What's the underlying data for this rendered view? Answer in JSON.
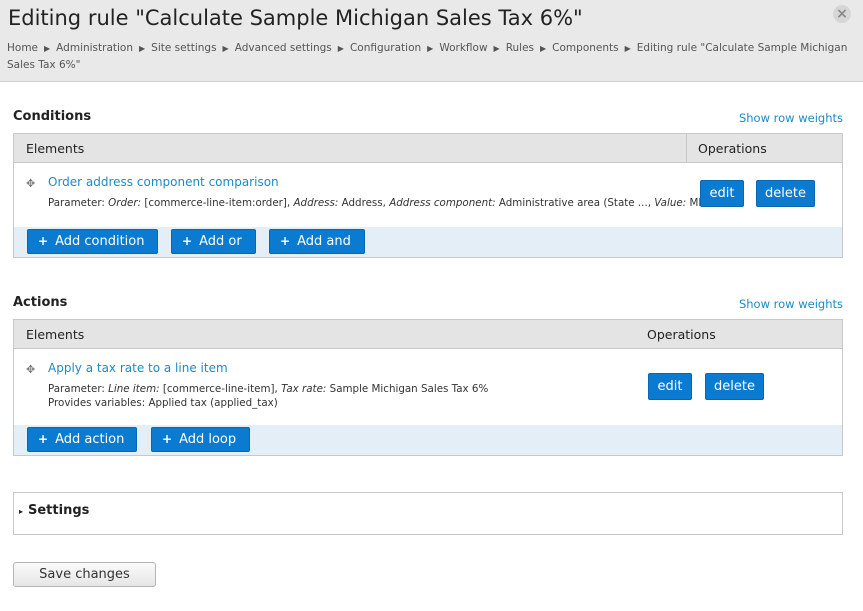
{
  "header": {
    "title": "Editing rule \"Calculate Sample Michigan Sales Tax 6%\"",
    "close_label": "×",
    "breadcrumb": [
      "Home",
      "Administration",
      "Site settings",
      "Advanced settings",
      "Configuration",
      "Workflow",
      "Rules",
      "Components",
      "Editing rule \"Calculate Sample Michigan Sales Tax 6%\""
    ],
    "breadcrumb_separator": "▶"
  },
  "conditions": {
    "title": "Conditions",
    "row_weights_link": "Show row weights",
    "col_elements": "Elements",
    "col_operations": "Operations",
    "row": {
      "label": "Order address component comparison",
      "param_prefix": "Parameter: ",
      "params": [
        {
          "name": "Order:",
          "value": " [commerce-line-item:order], "
        },
        {
          "name": "Address:",
          "value": " Address, "
        },
        {
          "name": "Address component:",
          "value": " Administrative area (State ..., "
        },
        {
          "name": "Value:",
          "value": " MI"
        }
      ],
      "edit_label": "edit",
      "delete_label": "delete"
    },
    "add_buttons": [
      "Add condition",
      "Add or",
      "Add and"
    ]
  },
  "actions": {
    "title": "Actions",
    "row_weights_link": "Show row weights",
    "col_elements": "Elements",
    "col_operations": "Operations",
    "row": {
      "label": "Apply a tax rate to a line item",
      "param_prefix": "Parameter: ",
      "params": [
        {
          "name": "Line item:",
          "value": " [commerce-line-item], "
        },
        {
          "name": "Tax rate:",
          "value": " Sample Michigan Sales Tax 6%"
        }
      ],
      "provides": "Provides variables: Applied tax (applied_tax)",
      "edit_label": "edit",
      "delete_label": "delete"
    },
    "add_buttons": [
      "Add action",
      "Add loop"
    ]
  },
  "settings": {
    "label": "Settings",
    "toggle_icon": "▸"
  },
  "save_button": "Save changes",
  "colors": {
    "accent": "#0a7bd0",
    "link": "#1a8bc9",
    "header_bg": "#e9e9e9",
    "footer_bg": "#e4eef6"
  }
}
